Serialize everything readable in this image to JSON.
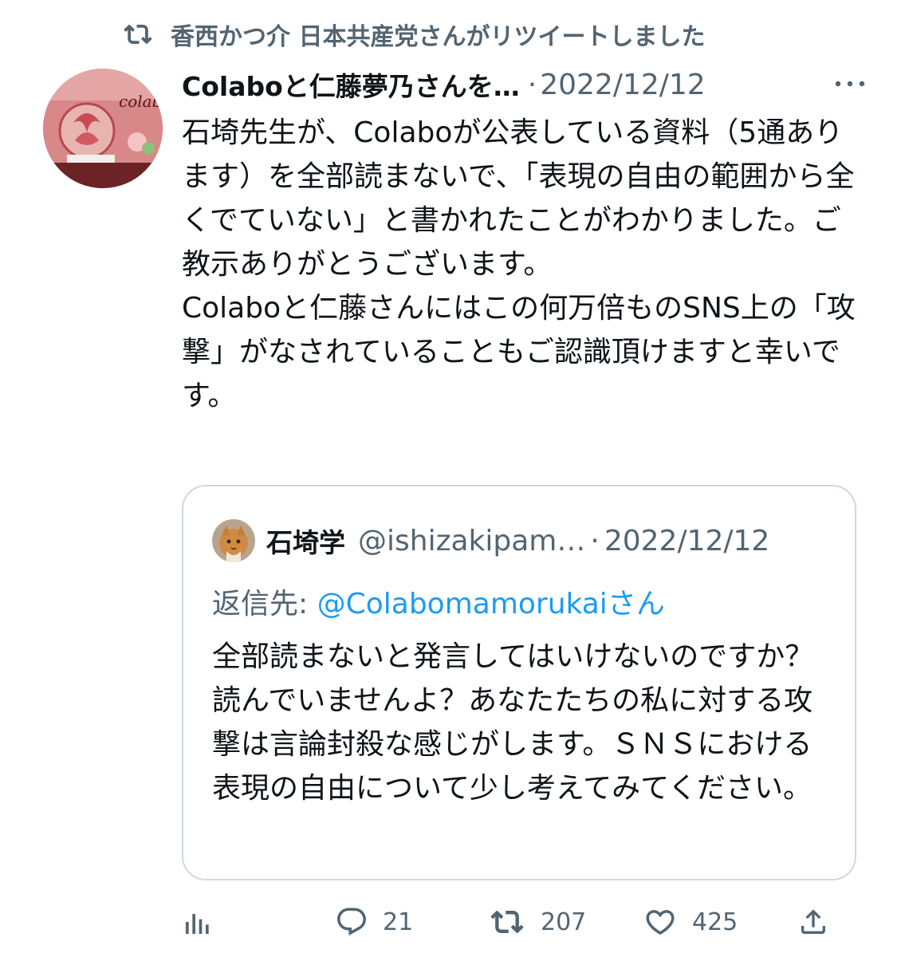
{
  "retweet": {
    "icon": "retweet-icon",
    "text": "香西かつ介 日本共産党さんがリツイートしました"
  },
  "tweet": {
    "author": "Colaboと仁藤夢乃さんを…",
    "separator": "·",
    "date": "2022/12/12",
    "more_icon": "more-icon",
    "avatar_label": "colabo",
    "paragraphs": [
      "石埼先生が、Colaboが公表している資料（5通あります）を全部読まないで、「表現の自由の範囲から全くでていない」と書かれたことがわかりました。ご教示ありがとうございます。",
      "Colaboと仁藤さんにはこの何万倍ものSNS上の「攻撃」がなされていることもご認識頂けますと幸いです。"
    ]
  },
  "quote": {
    "name": "石埼学",
    "handle": "@ishizakipam…",
    "separator": "·",
    "date": "2022/12/12",
    "reply_prefix": "返信先:",
    "reply_mention": "@Colabomamorukai",
    "reply_suffix": "さん",
    "text": "全部読まないと発言してはいけないのですか？読んでいませんよ？あなたたちの私に対する攻撃は言論封殺な感じがします。ＳＮＳにおける表現の自由について少し考えてみてください。"
  },
  "actions": {
    "views_icon": "analytics-icon",
    "reply_icon": "reply-icon",
    "reply_count": "21",
    "retweet_icon": "retweet-icon",
    "retweet_count": "207",
    "like_icon": "heart-icon",
    "like_count": "425",
    "share_icon": "share-icon"
  },
  "colors": {
    "text": "#0f1419",
    "secondary": "#536471",
    "link": "#1d9bf0",
    "border": "#cfd9de"
  }
}
